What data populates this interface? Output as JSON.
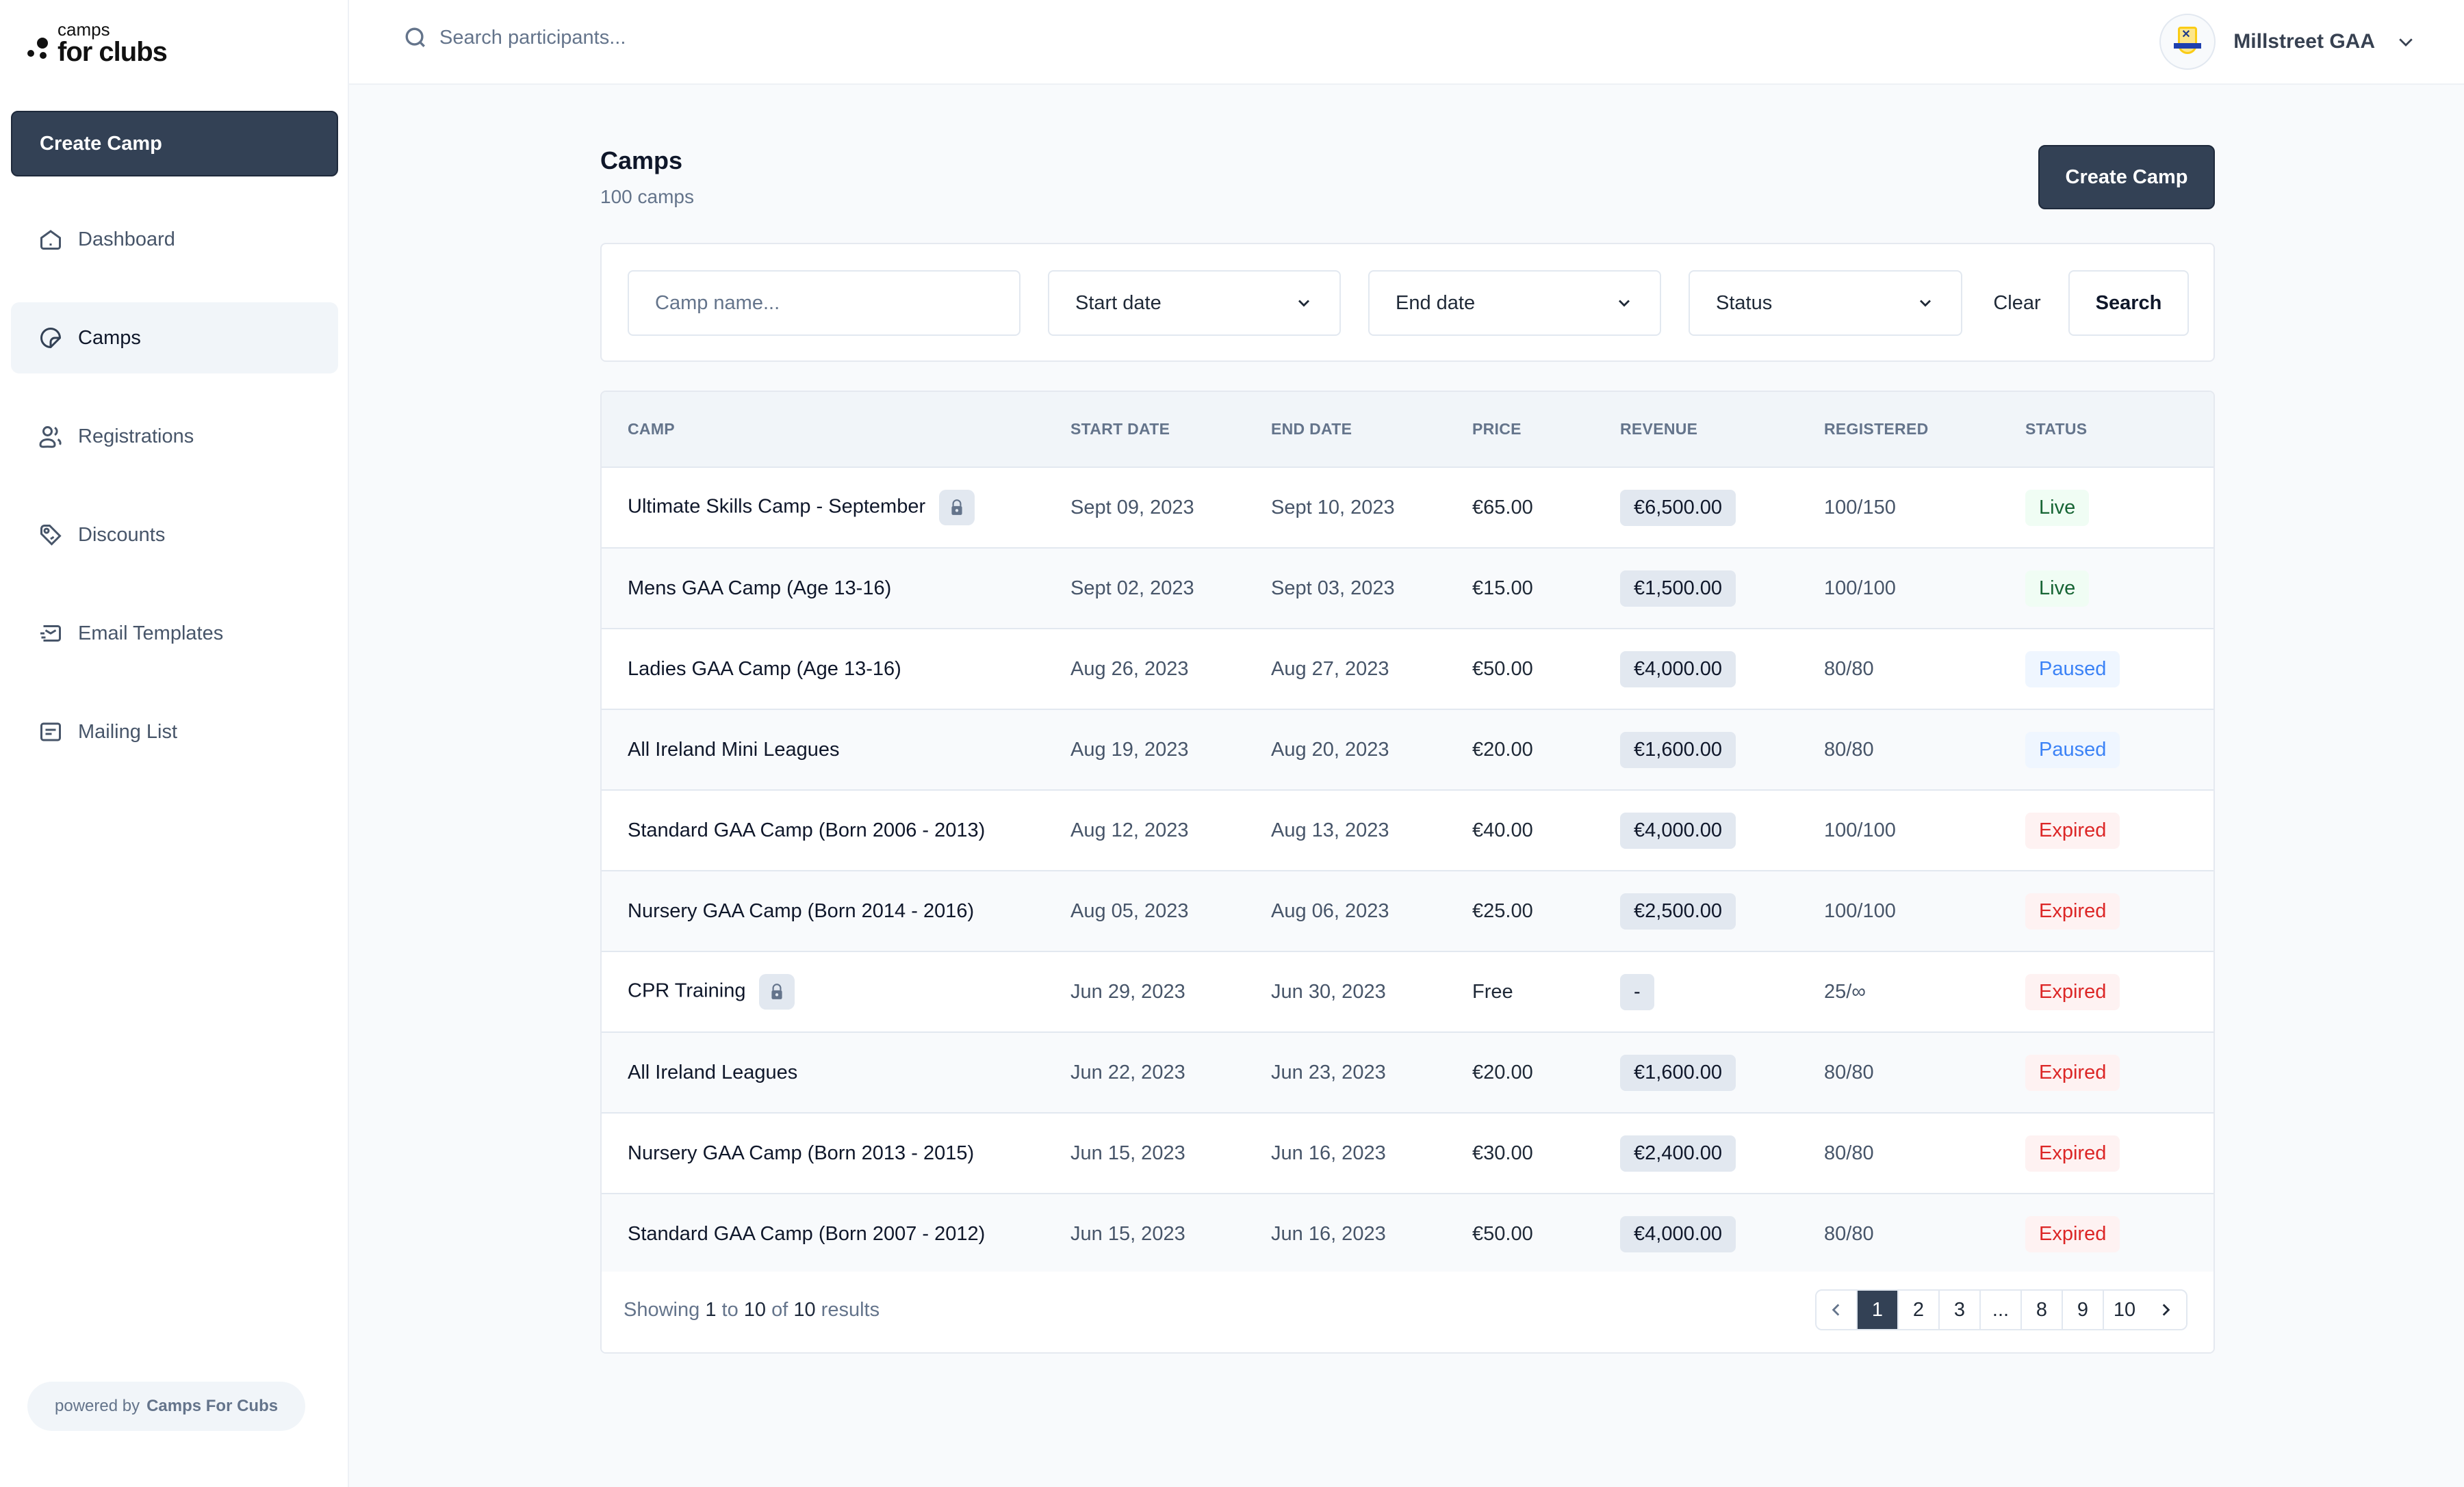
{
  "brand": {
    "logo_line1": "camps",
    "logo_line2": "for clubs"
  },
  "sidebar": {
    "create_label": "Create Camp",
    "items": [
      {
        "label": "Dashboard",
        "icon": "home-icon",
        "active": false
      },
      {
        "label": "Camps",
        "icon": "sticker-icon",
        "active": true
      },
      {
        "label": "Registrations",
        "icon": "users-icon",
        "active": false
      },
      {
        "label": "Discounts",
        "icon": "tag-icon",
        "active": false
      },
      {
        "label": "Email Templates",
        "icon": "mail-icon",
        "active": false
      },
      {
        "label": "Mailing List",
        "icon": "list-icon",
        "active": false
      }
    ],
    "powered_prefix": "powered by",
    "powered_brand": "Camps For Cubs"
  },
  "header": {
    "search_placeholder": "Search participants...",
    "account_name": "Millstreet GAA"
  },
  "page": {
    "title": "Camps",
    "subtitle": "100 camps",
    "create_label": "Create Camp"
  },
  "filters": {
    "name_placeholder": "Camp name...",
    "start_date": "Start date",
    "end_date": "End date",
    "status": "Status",
    "clear_label": "Clear",
    "search_label": "Search"
  },
  "table": {
    "columns": [
      "CAMP",
      "START DATE",
      "END DATE",
      "PRICE",
      "REVENUE",
      "REGISTERED",
      "STATUS"
    ],
    "rows": [
      {
        "camp": "Ultimate Skills Camp - September",
        "locked": true,
        "start": "Sept 09, 2023",
        "end": "Sept 10, 2023",
        "price": "€65.00",
        "revenue": "€6,500.00",
        "registered": "100/150",
        "status": "Live"
      },
      {
        "camp": "Mens GAA Camp (Age 13-16)",
        "locked": false,
        "start": "Sept 02, 2023",
        "end": "Sept 03, 2023",
        "price": "€15.00",
        "revenue": "€1,500.00",
        "registered": "100/100",
        "status": "Live"
      },
      {
        "camp": "Ladies GAA Camp (Age 13-16)",
        "locked": false,
        "start": "Aug 26, 2023",
        "end": "Aug 27, 2023",
        "price": "€50.00",
        "revenue": "€4,000.00",
        "registered": "80/80",
        "status": "Paused"
      },
      {
        "camp": "All Ireland Mini Leagues",
        "locked": false,
        "start": "Aug 19, 2023",
        "end": "Aug 20, 2023",
        "price": "€20.00",
        "revenue": "€1,600.00",
        "registered": "80/80",
        "status": "Paused"
      },
      {
        "camp": "Standard GAA Camp (Born 2006 - 2013)",
        "locked": false,
        "start": "Aug 12, 2023",
        "end": "Aug 13, 2023",
        "price": "€40.00",
        "revenue": "€4,000.00",
        "registered": "100/100",
        "status": "Expired"
      },
      {
        "camp": "Nursery GAA Camp (Born 2014 - 2016)",
        "locked": false,
        "start": "Aug 05, 2023",
        "end": "Aug 06, 2023",
        "price": "€25.00",
        "revenue": "€2,500.00",
        "registered": "100/100",
        "status": "Expired"
      },
      {
        "camp": "CPR Training",
        "locked": true,
        "start": "Jun 29, 2023",
        "end": "Jun 30, 2023",
        "price": "Free",
        "revenue": "-",
        "registered": "25/∞",
        "status": "Expired"
      },
      {
        "camp": "All Ireland Leagues",
        "locked": false,
        "start": "Jun 22, 2023",
        "end": "Jun 23, 2023",
        "price": "€20.00",
        "revenue": "€1,600.00",
        "registered": "80/80",
        "status": "Expired"
      },
      {
        "camp": "Nursery GAA Camp (Born 2013 - 2015)",
        "locked": false,
        "start": "Jun 15, 2023",
        "end": "Jun 16, 2023",
        "price": "€30.00",
        "revenue": "€2,400.00",
        "registered": "80/80",
        "status": "Expired"
      },
      {
        "camp": "Standard GAA Camp (Born 2007 - 2012)",
        "locked": false,
        "start": "Jun 15, 2023",
        "end": "Jun 16, 2023",
        "price": "€50.00",
        "revenue": "€4,000.00",
        "registered": "80/80",
        "status": "Expired"
      }
    ]
  },
  "footer": {
    "showing_prefix": "Showing",
    "from": "1",
    "to_word": "to",
    "to": "10",
    "of_word": "of",
    "total": "10",
    "results_word": "results",
    "pages": [
      "1",
      "2",
      "3",
      "...",
      "8",
      "9",
      "10"
    ],
    "current_page": "1"
  },
  "colors": {
    "primary": "#334155",
    "live": "#166534",
    "paused": "#3b82f6",
    "expired": "#dc2626"
  }
}
